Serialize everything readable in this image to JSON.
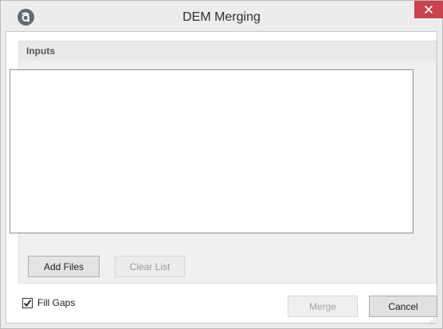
{
  "window": {
    "title": "DEM Merging",
    "app_icon": "a-logo-icon",
    "close_icon": "close-icon"
  },
  "inputs": {
    "header": "Inputs",
    "files": []
  },
  "buttons": {
    "add_files": "Add Files",
    "clear_list": "Clear List",
    "merge": "Merge",
    "cancel": "Cancel"
  },
  "options": {
    "fill_gaps_label": "Fill Gaps",
    "fill_gaps_checked": true
  },
  "colors": {
    "close_button": "#c7434d",
    "app_icon": "#5f6b7a"
  }
}
